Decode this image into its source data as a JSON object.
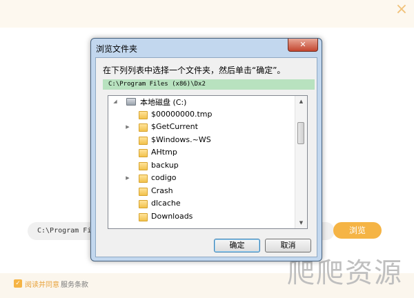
{
  "installer": {
    "path_value": "C:\\Program Files (x86)\\Dx2",
    "browse_label": "浏览",
    "agree_label": "阅读并同意",
    "terms_link": "服务条款",
    "watermark_text": "爬爬资源",
    "accent_color": "#f5b445"
  },
  "dialog": {
    "title": "浏览文件夹",
    "close_label": "✕",
    "instruction": "在下列列表中选择一个文件夹，然后单击“确定”。",
    "current_path": "C:\\Program Files (x86)\\Dx2",
    "ok_label": "确定",
    "cancel_label": "取消",
    "tree": {
      "drive_label": "本地磁盘 (C:)",
      "drive_icon": "drive-icon",
      "folder_icon": "folder-icon",
      "folders": [
        {
          "label": "$00000000.tmp",
          "expandable": false
        },
        {
          "label": "$GetCurrent",
          "expandable": true
        },
        {
          "label": "$Windows.~WS",
          "expandable": false
        },
        {
          "label": "AHtmp",
          "expandable": false
        },
        {
          "label": "backup",
          "expandable": false
        },
        {
          "label": "codigo",
          "expandable": true
        },
        {
          "label": "Crash",
          "expandable": false
        },
        {
          "label": "dlcache",
          "expandable": false
        },
        {
          "label": "Downloads",
          "expandable": false
        }
      ]
    }
  }
}
